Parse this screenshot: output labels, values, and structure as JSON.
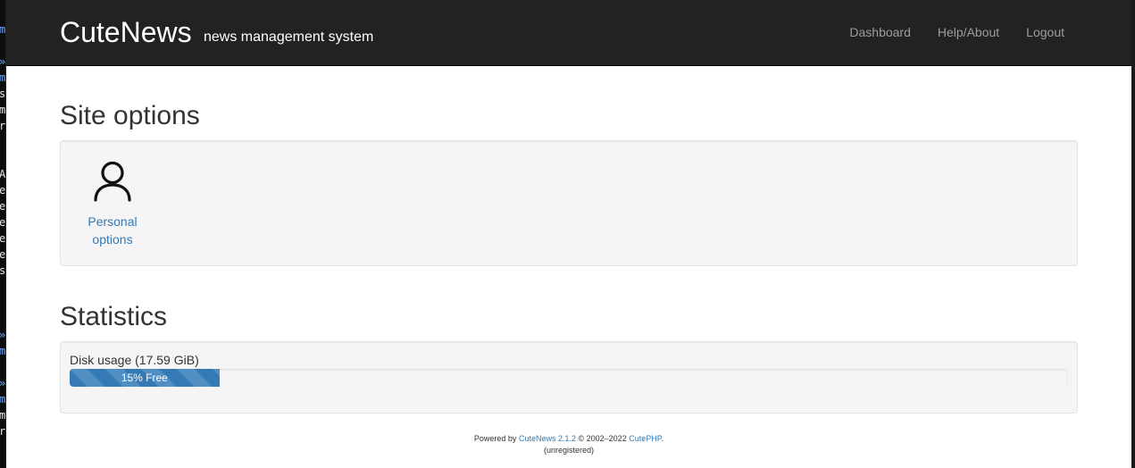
{
  "header": {
    "brand": "CuteNews",
    "tagline": "news management system",
    "nav": [
      {
        "label": "Dashboard"
      },
      {
        "label": "Help/About"
      },
      {
        "label": "Logout"
      }
    ]
  },
  "site_options": {
    "title": "Site options",
    "items": [
      {
        "label_line1": "Personal",
        "label_line2": "options",
        "icon": "user-icon"
      }
    ]
  },
  "statistics": {
    "title": "Statistics",
    "disk_usage_label": "Disk usage (17.59 GiB)",
    "free_percent": 15,
    "free_label": "15% Free"
  },
  "footer": {
    "powered_by": "Powered by",
    "product_link": "CuteNews 2.1.2",
    "copyright": "© 2002–2022",
    "company_link": "CutePHP",
    "period": ".",
    "registration": "(unregistered)"
  },
  "background_terminal": {
    "chars": [
      "m",
      "»",
      "m",
      "s",
      "m",
      "r",
      "A",
      "e",
      "e",
      "e",
      "e",
      "e",
      "s",
      "»",
      "m",
      "»",
      "m",
      "m",
      "r"
    ]
  },
  "colors": {
    "navbar": "#222222",
    "link": "#337ab7",
    "progress": "#337ab7"
  }
}
